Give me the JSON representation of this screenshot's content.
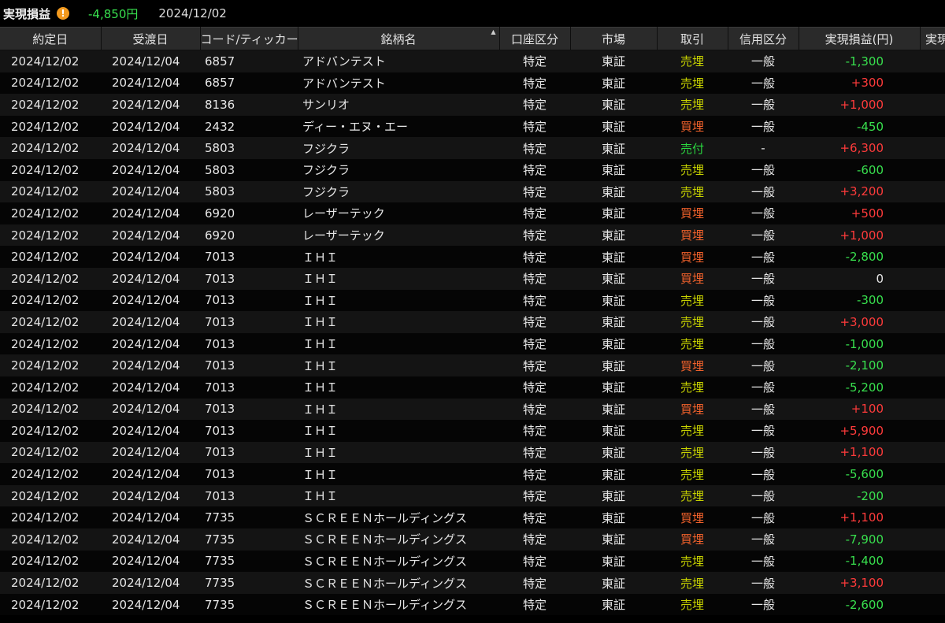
{
  "header": {
    "title": "実現損益",
    "warning_icon": "!",
    "total": "-4,850円",
    "date": "2024/12/02"
  },
  "columns": [
    "約定日",
    "受渡日",
    "コード/ティッカー",
    "銘柄名",
    "口座区分",
    "市場",
    "取引",
    "信用区分",
    "実現損益(円)",
    "実現"
  ],
  "rows": [
    {
      "trade_date": "2024/12/02",
      "settle_date": "2024/12/04",
      "code": "6857",
      "name": "アドバンテスト",
      "account": "特定",
      "market": "東証",
      "trade": "売埋",
      "trade_type": "sell",
      "credit": "一般",
      "pl": "-1,300",
      "pl_sign": "neg"
    },
    {
      "trade_date": "2024/12/02",
      "settle_date": "2024/12/04",
      "code": "6857",
      "name": "アドバンテスト",
      "account": "特定",
      "market": "東証",
      "trade": "売埋",
      "trade_type": "sell",
      "credit": "一般",
      "pl": "+300",
      "pl_sign": "pos"
    },
    {
      "trade_date": "2024/12/02",
      "settle_date": "2024/12/04",
      "code": "8136",
      "name": "サンリオ",
      "account": "特定",
      "market": "東証",
      "trade": "売埋",
      "trade_type": "sell",
      "credit": "一般",
      "pl": "+1,000",
      "pl_sign": "pos"
    },
    {
      "trade_date": "2024/12/02",
      "settle_date": "2024/12/04",
      "code": "2432",
      "name": "ディー・エヌ・エー",
      "account": "特定",
      "market": "東証",
      "trade": "買埋",
      "trade_type": "buy",
      "credit": "一般",
      "pl": "-450",
      "pl_sign": "neg"
    },
    {
      "trade_date": "2024/12/02",
      "settle_date": "2024/12/04",
      "code": "5803",
      "name": "フジクラ",
      "account": "特定",
      "market": "東証",
      "trade": "売付",
      "trade_type": "sellnew",
      "credit": "-",
      "pl": "+6,300",
      "pl_sign": "pos"
    },
    {
      "trade_date": "2024/12/02",
      "settle_date": "2024/12/04",
      "code": "5803",
      "name": "フジクラ",
      "account": "特定",
      "market": "東証",
      "trade": "売埋",
      "trade_type": "sell",
      "credit": "一般",
      "pl": "-600",
      "pl_sign": "neg"
    },
    {
      "trade_date": "2024/12/02",
      "settle_date": "2024/12/04",
      "code": "5803",
      "name": "フジクラ",
      "account": "特定",
      "market": "東証",
      "trade": "売埋",
      "trade_type": "sell",
      "credit": "一般",
      "pl": "+3,200",
      "pl_sign": "pos"
    },
    {
      "trade_date": "2024/12/02",
      "settle_date": "2024/12/04",
      "code": "6920",
      "name": "レーザーテック",
      "account": "特定",
      "market": "東証",
      "trade": "買埋",
      "trade_type": "buy",
      "credit": "一般",
      "pl": "+500",
      "pl_sign": "pos"
    },
    {
      "trade_date": "2024/12/02",
      "settle_date": "2024/12/04",
      "code": "6920",
      "name": "レーザーテック",
      "account": "特定",
      "market": "東証",
      "trade": "買埋",
      "trade_type": "buy",
      "credit": "一般",
      "pl": "+1,000",
      "pl_sign": "pos"
    },
    {
      "trade_date": "2024/12/02",
      "settle_date": "2024/12/04",
      "code": "7013",
      "name": "ＩＨＩ",
      "account": "特定",
      "market": "東証",
      "trade": "買埋",
      "trade_type": "buy",
      "credit": "一般",
      "pl": "-2,800",
      "pl_sign": "neg"
    },
    {
      "trade_date": "2024/12/02",
      "settle_date": "2024/12/04",
      "code": "7013",
      "name": "ＩＨＩ",
      "account": "特定",
      "market": "東証",
      "trade": "買埋",
      "trade_type": "buy",
      "credit": "一般",
      "pl": "0",
      "pl_sign": "zero"
    },
    {
      "trade_date": "2024/12/02",
      "settle_date": "2024/12/04",
      "code": "7013",
      "name": "ＩＨＩ",
      "account": "特定",
      "market": "東証",
      "trade": "売埋",
      "trade_type": "sell",
      "credit": "一般",
      "pl": "-300",
      "pl_sign": "neg"
    },
    {
      "trade_date": "2024/12/02",
      "settle_date": "2024/12/04",
      "code": "7013",
      "name": "ＩＨＩ",
      "account": "特定",
      "market": "東証",
      "trade": "売埋",
      "trade_type": "sell",
      "credit": "一般",
      "pl": "+3,000",
      "pl_sign": "pos"
    },
    {
      "trade_date": "2024/12/02",
      "settle_date": "2024/12/04",
      "code": "7013",
      "name": "ＩＨＩ",
      "account": "特定",
      "market": "東証",
      "trade": "売埋",
      "trade_type": "sell",
      "credit": "一般",
      "pl": "-1,000",
      "pl_sign": "neg"
    },
    {
      "trade_date": "2024/12/02",
      "settle_date": "2024/12/04",
      "code": "7013",
      "name": "ＩＨＩ",
      "account": "特定",
      "market": "東証",
      "trade": "買埋",
      "trade_type": "buy",
      "credit": "一般",
      "pl": "-2,100",
      "pl_sign": "neg"
    },
    {
      "trade_date": "2024/12/02",
      "settle_date": "2024/12/04",
      "code": "7013",
      "name": "ＩＨＩ",
      "account": "特定",
      "market": "東証",
      "trade": "売埋",
      "trade_type": "sell",
      "credit": "一般",
      "pl": "-5,200",
      "pl_sign": "neg"
    },
    {
      "trade_date": "2024/12/02",
      "settle_date": "2024/12/04",
      "code": "7013",
      "name": "ＩＨＩ",
      "account": "特定",
      "market": "東証",
      "trade": "買埋",
      "trade_type": "buy",
      "credit": "一般",
      "pl": "+100",
      "pl_sign": "pos"
    },
    {
      "trade_date": "2024/12/02",
      "settle_date": "2024/12/04",
      "code": "7013",
      "name": "ＩＨＩ",
      "account": "特定",
      "market": "東証",
      "trade": "売埋",
      "trade_type": "sell",
      "credit": "一般",
      "pl": "+5,900",
      "pl_sign": "pos"
    },
    {
      "trade_date": "2024/12/02",
      "settle_date": "2024/12/04",
      "code": "7013",
      "name": "ＩＨＩ",
      "account": "特定",
      "market": "東証",
      "trade": "売埋",
      "trade_type": "sell",
      "credit": "一般",
      "pl": "+1,100",
      "pl_sign": "pos"
    },
    {
      "trade_date": "2024/12/02",
      "settle_date": "2024/12/04",
      "code": "7013",
      "name": "ＩＨＩ",
      "account": "特定",
      "market": "東証",
      "trade": "売埋",
      "trade_type": "sell",
      "credit": "一般",
      "pl": "-5,600",
      "pl_sign": "neg"
    },
    {
      "trade_date": "2024/12/02",
      "settle_date": "2024/12/04",
      "code": "7013",
      "name": "ＩＨＩ",
      "account": "特定",
      "market": "東証",
      "trade": "売埋",
      "trade_type": "sell",
      "credit": "一般",
      "pl": "-200",
      "pl_sign": "neg"
    },
    {
      "trade_date": "2024/12/02",
      "settle_date": "2024/12/04",
      "code": "7735",
      "name": "ＳＣＲＥＥＮホールディングス",
      "account": "特定",
      "market": "東証",
      "trade": "買埋",
      "trade_type": "buy",
      "credit": "一般",
      "pl": "+1,100",
      "pl_sign": "pos"
    },
    {
      "trade_date": "2024/12/02",
      "settle_date": "2024/12/04",
      "code": "7735",
      "name": "ＳＣＲＥＥＮホールディングス",
      "account": "特定",
      "market": "東証",
      "trade": "買埋",
      "trade_type": "buy",
      "credit": "一般",
      "pl": "-7,900",
      "pl_sign": "neg"
    },
    {
      "trade_date": "2024/12/02",
      "settle_date": "2024/12/04",
      "code": "7735",
      "name": "ＳＣＲＥＥＮホールディングス",
      "account": "特定",
      "market": "東証",
      "trade": "売埋",
      "trade_type": "sell",
      "credit": "一般",
      "pl": "-1,400",
      "pl_sign": "neg"
    },
    {
      "trade_date": "2024/12/02",
      "settle_date": "2024/12/04",
      "code": "7735",
      "name": "ＳＣＲＥＥＮホールディングス",
      "account": "特定",
      "market": "東証",
      "trade": "売埋",
      "trade_type": "sell",
      "credit": "一般",
      "pl": "+3,100",
      "pl_sign": "pos"
    },
    {
      "trade_date": "2024/12/02",
      "settle_date": "2024/12/04",
      "code": "7735",
      "name": "ＳＣＲＥＥＮホールディングス",
      "account": "特定",
      "market": "東証",
      "trade": "売埋",
      "trade_type": "sell",
      "credit": "一般",
      "pl": "-2,600",
      "pl_sign": "neg"
    }
  ],
  "colors": {
    "background": "#000000",
    "header_bg": "#2a2a2a",
    "positive": "#ff3b3b",
    "negative": "#38e04e",
    "sell_close": "#c7d200",
    "buy_close": "#f0612b",
    "sell_open": "#2ad63f",
    "warning": "#f39a1e"
  }
}
